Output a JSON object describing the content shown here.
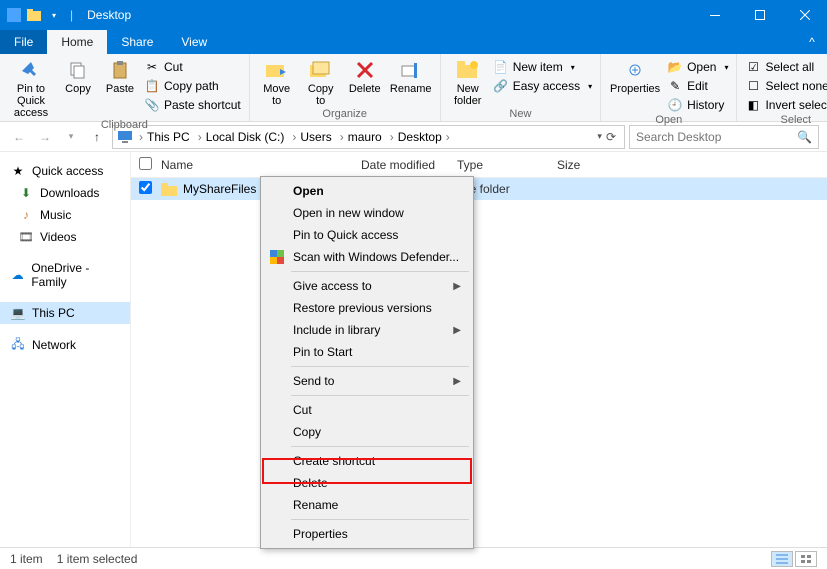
{
  "titlebar": {
    "title": "Desktop"
  },
  "tabs": {
    "file": "File",
    "home": "Home",
    "share": "Share",
    "view": "View"
  },
  "ribbon": {
    "clipboard": {
      "label": "Clipboard",
      "pin": "Pin to Quick\naccess",
      "copy": "Copy",
      "paste": "Paste",
      "cut": "Cut",
      "copypath": "Copy path",
      "pasteshortcut": "Paste shortcut"
    },
    "organize": {
      "label": "Organize",
      "moveto": "Move\nto",
      "copyto": "Copy\nto",
      "delete": "Delete",
      "rename": "Rename"
    },
    "new": {
      "label": "New",
      "newfolder": "New\nfolder",
      "newitem": "New item",
      "easyaccess": "Easy access"
    },
    "open": {
      "label": "Open",
      "properties": "Properties",
      "open": "Open",
      "edit": "Edit",
      "history": "History"
    },
    "select": {
      "label": "Select",
      "all": "Select all",
      "none": "Select none",
      "invert": "Invert selection"
    }
  },
  "breadcrumbs": [
    "This PC",
    "Local Disk (C:)",
    "Users",
    "mauro",
    "Desktop"
  ],
  "search": {
    "placeholder": "Search Desktop"
  },
  "sidebar": {
    "quick": "Quick access",
    "downloads": "Downloads",
    "music": "Music",
    "videos": "Videos",
    "onedrive": "OneDrive - Family",
    "thispc": "This PC",
    "network": "Network"
  },
  "columns": {
    "name": "Name",
    "date": "Date modified",
    "type": "Type",
    "size": "Size"
  },
  "file": {
    "name": "MyShareFiles",
    "type": "File folder"
  },
  "ctx": {
    "open": "Open",
    "opennew": "Open in new window",
    "pinquick": "Pin to Quick access",
    "defender": "Scan with Windows Defender...",
    "giveaccess": "Give access to",
    "restore": "Restore previous versions",
    "include": "Include in library",
    "pinstart": "Pin to Start",
    "sendto": "Send to",
    "cut": "Cut",
    "copy": "Copy",
    "shortcut": "Create shortcut",
    "delete": "Delete",
    "rename": "Rename",
    "properties": "Properties"
  },
  "status": {
    "items": "1 item",
    "selected": "1 item selected"
  }
}
